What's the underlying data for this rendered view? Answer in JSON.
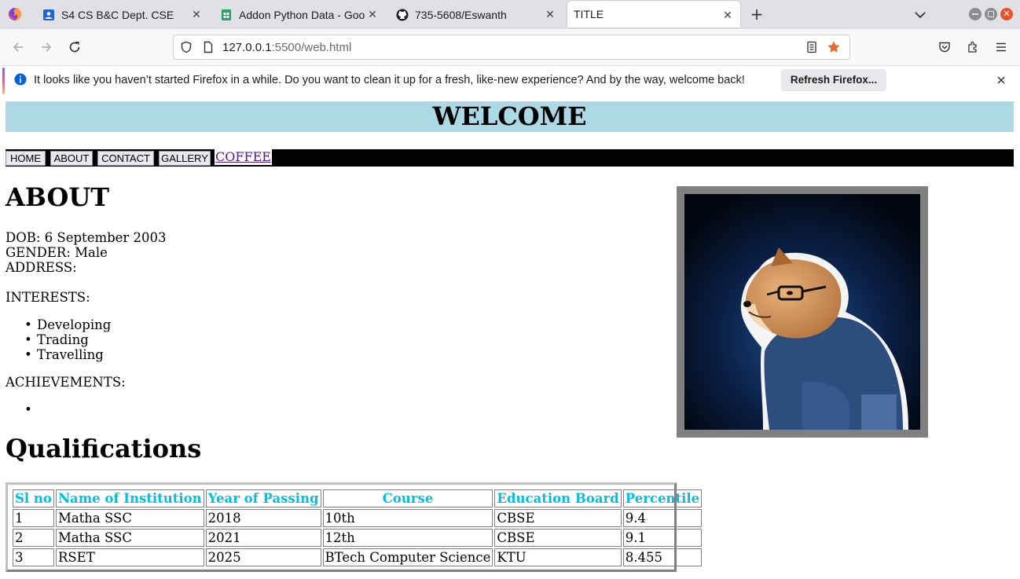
{
  "browser": {
    "tabs": [
      {
        "title": "S4 CS B&C Dept. CSE",
        "icon": "classroom-icon"
      },
      {
        "title": "Addon Python Data - Goo",
        "icon": "sheets-icon"
      },
      {
        "title": "735-5608/Eswanth",
        "icon": "github-icon"
      },
      {
        "title": "TITLE",
        "icon": "none",
        "active": true
      }
    ],
    "url_host": "127.0.0.1",
    "url_rest": ":5500/web.html",
    "infobar": {
      "message": "It looks like you haven’t started Firefox in a while. Do you want to clean it up for a fresh, like-new experience? And by the way, welcome back!",
      "button": "Refresh Firefox..."
    },
    "colors": {
      "accent": "#9059ff",
      "bookmark_star": "#e66a2c"
    }
  },
  "page": {
    "banner": "WELCOME",
    "nav": [
      "HOME",
      "ABOUT",
      "CONTACT",
      "GALLERY"
    ],
    "nav_link": "COFFEE",
    "about_heading": "ABOUT",
    "dob": "DOB: 6 September 2003",
    "gender": "GENDER: Male",
    "address": "ADDRESS:",
    "interests_label": "INTERESTS:",
    "interests": [
      "Developing",
      "Trading",
      "Travelling"
    ],
    "achievements_label": "ACHIEVEMENTS:",
    "achievements": [
      ""
    ],
    "qual_heading": "Qualifications",
    "table": {
      "headers": [
        "Sl no",
        "Name of Institution",
        "Year of Passing",
        "Course",
        "Education Board",
        "Percentile"
      ],
      "rows": [
        [
          "1",
          "Matha SSC",
          "2018",
          "10th",
          "CBSE",
          "9.4"
        ],
        [
          "2",
          "Matha SSC",
          "2021",
          "12th",
          "CBSE",
          "9.1"
        ],
        [
          "3",
          "RSET",
          "2025",
          "BTech Computer Science",
          "KTU",
          "8.455"
        ]
      ]
    },
    "colors": {
      "banner_bg": "#add8e6",
      "table_header": "#00c0e0"
    }
  }
}
